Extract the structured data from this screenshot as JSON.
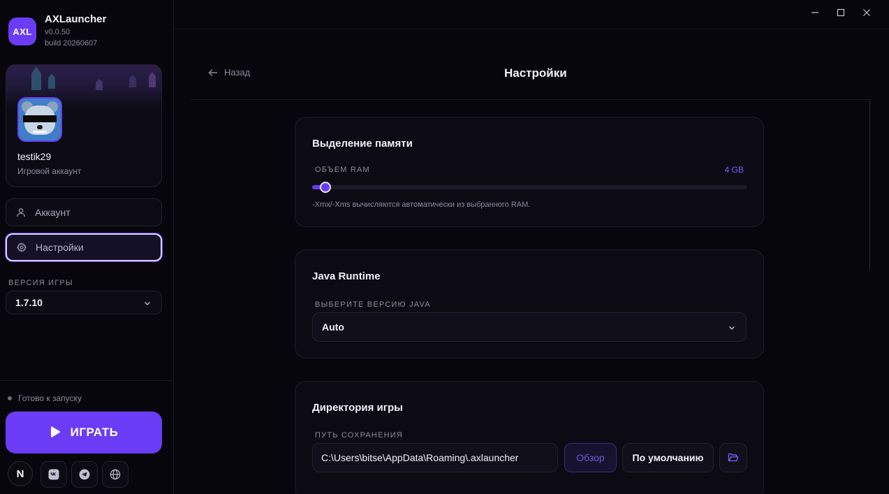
{
  "app": {
    "logo_text": "AXL",
    "name": "AXLauncher",
    "version": "v0.0.50",
    "build": "build 20260607",
    "accent": "#6b3cf5"
  },
  "profile": {
    "username": "testik29",
    "subtitle": "Игровой аккаунт"
  },
  "nav": {
    "items": [
      {
        "label": "Аккаунт",
        "icon": "user-icon",
        "active": false
      },
      {
        "label": "Настройки",
        "icon": "gear-icon",
        "active": true
      }
    ]
  },
  "game_version": {
    "label": "ВЕРСИЯ ИГРЫ",
    "selected": "1.7.10"
  },
  "status": {
    "text": "Готово к запуску"
  },
  "play": {
    "label": "ИГРАТЬ"
  },
  "social": {
    "items": [
      {
        "name": "n-icon",
        "glyph": "N"
      },
      {
        "name": "vk-icon",
        "glyph": "vk"
      },
      {
        "name": "telegram-icon",
        "glyph": ""
      },
      {
        "name": "globe-icon",
        "glyph": ""
      }
    ]
  },
  "header": {
    "back_label": "Назад",
    "title": "Настройки"
  },
  "memory": {
    "title": "Выделение памяти",
    "field_label": "ОБЪЕМ RAM",
    "value_label": "4 GB",
    "slider_fraction": 0.03,
    "hint": "-Xmx/-Xms вычисляются автоматически из выбранного RAM."
  },
  "java": {
    "title": "Java Runtime",
    "field_label": "ВЫБЕРИТЕ ВЕРСИЮ JAVA",
    "selected": "Auto"
  },
  "directory": {
    "title": "Директория игры",
    "field_label": "ПУТЬ СОХРАНЕНИЯ",
    "path": "C:\\Users\\bitse\\AppData\\Roaming\\.axlauncher",
    "browse_label": "Обзор",
    "default_label": "По умолчанию"
  }
}
